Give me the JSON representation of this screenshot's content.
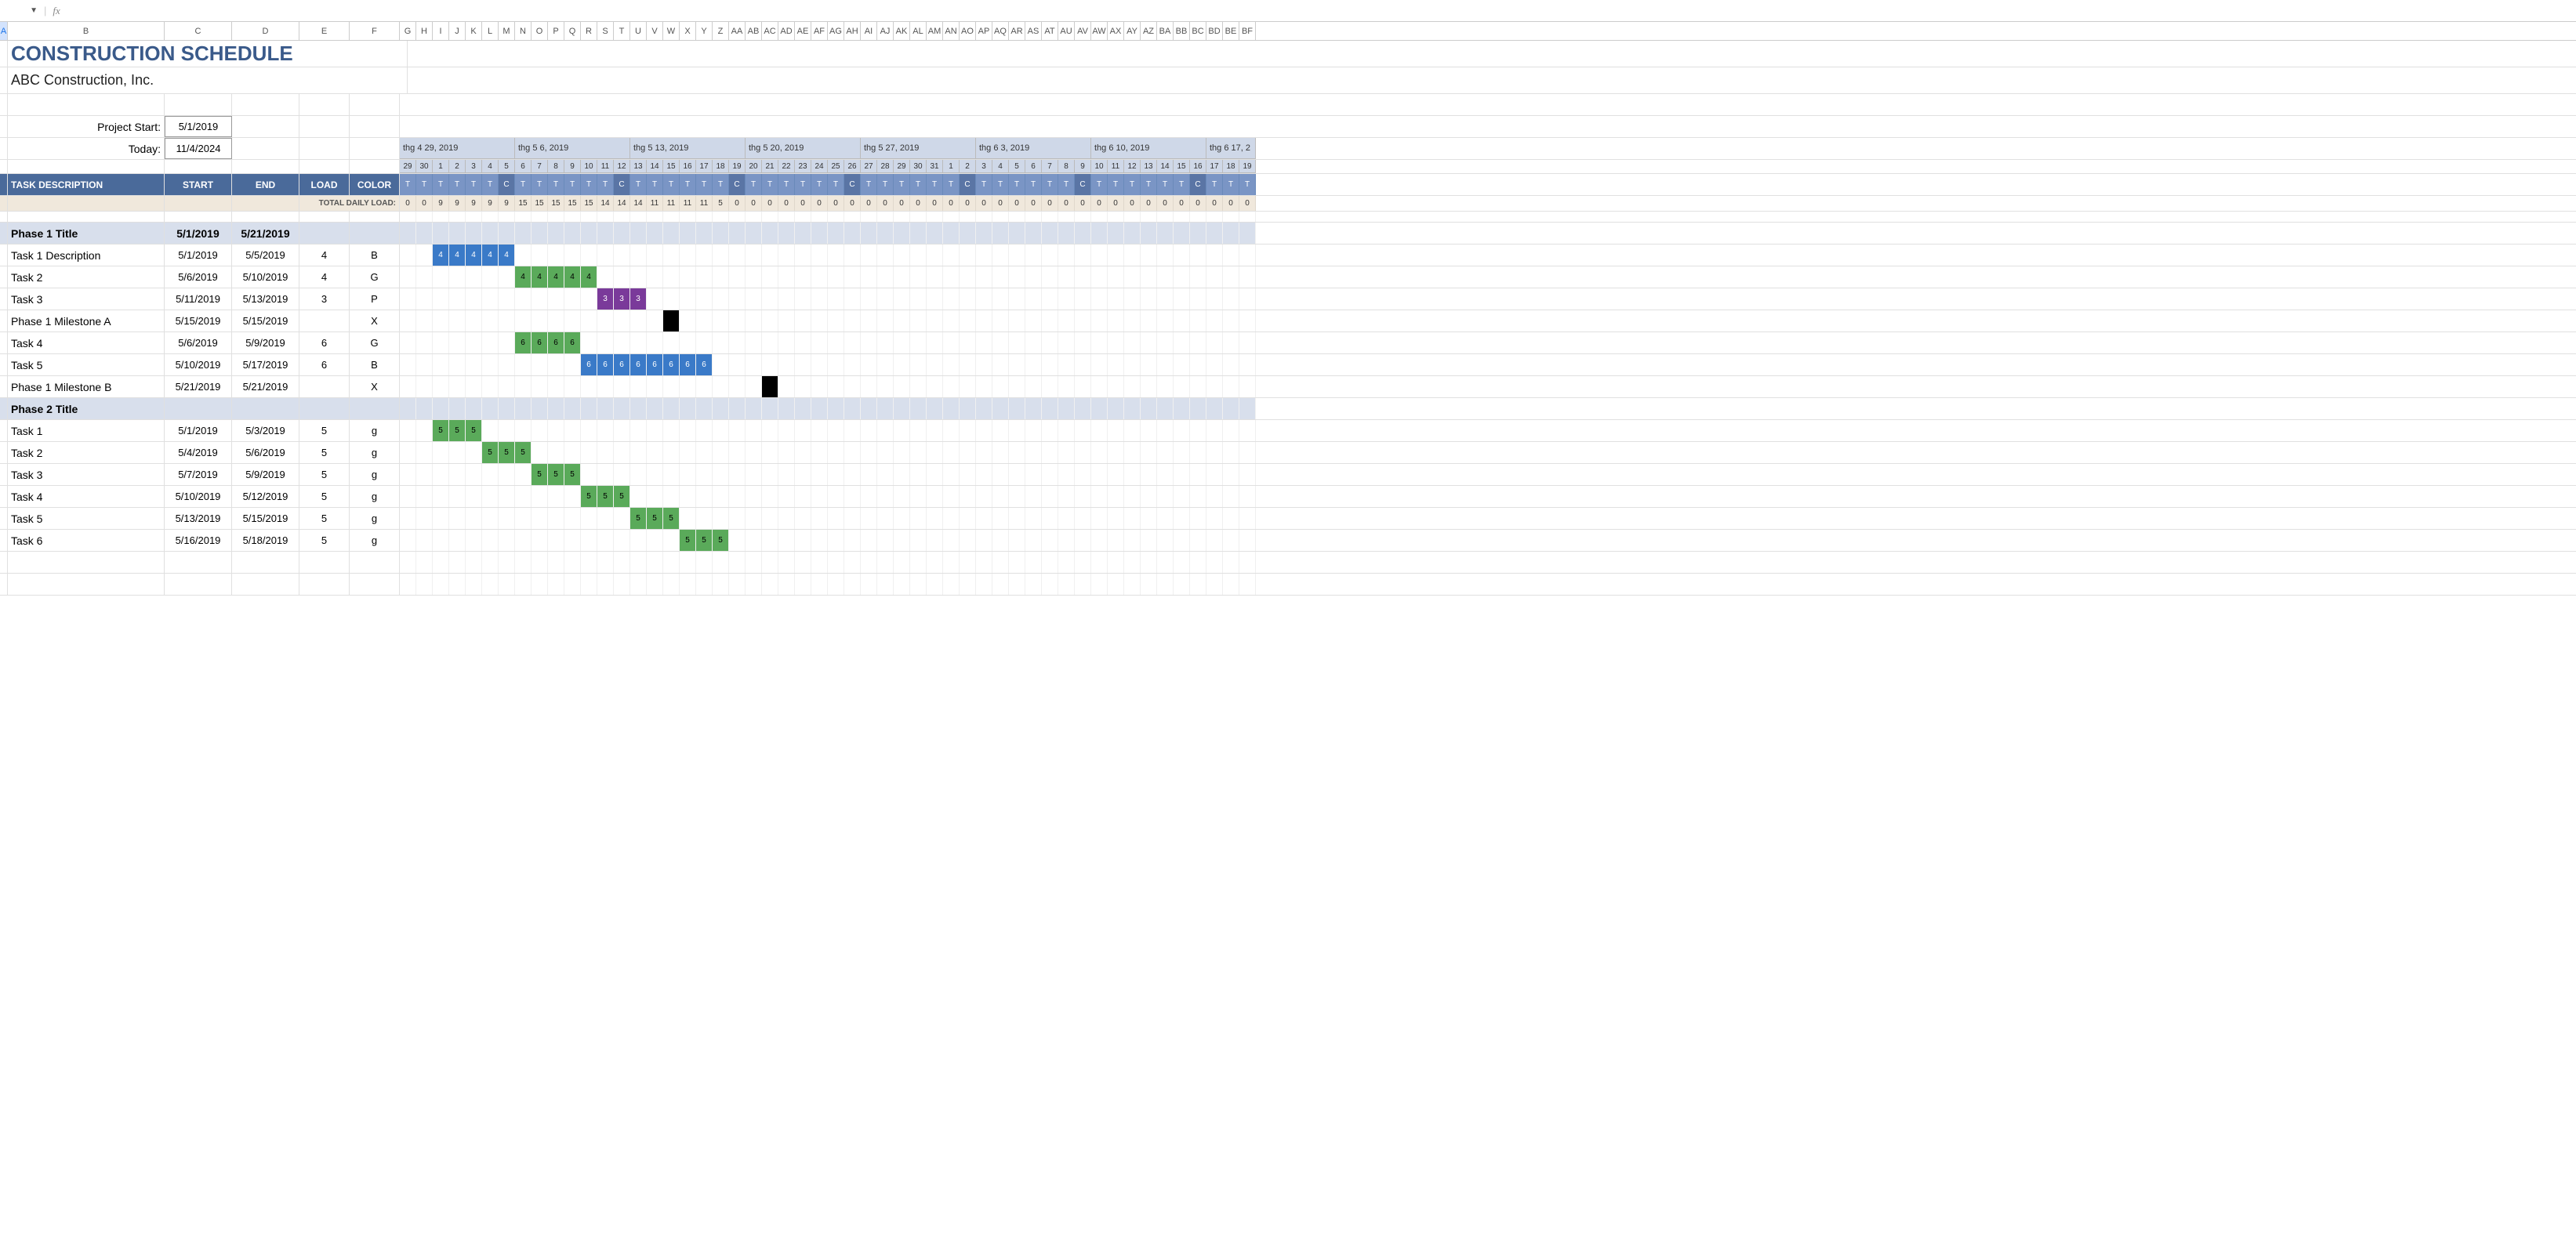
{
  "formula_bar": {
    "fx": "fx",
    "value": ""
  },
  "columns": [
    "A",
    "B",
    "C",
    "D",
    "E",
    "F",
    "G",
    "H",
    "I",
    "J",
    "K",
    "L",
    "M",
    "N",
    "O",
    "P",
    "Q",
    "R",
    "S",
    "T",
    "U",
    "V",
    "W",
    "X",
    "Y",
    "Z",
    "AA",
    "AB",
    "AC",
    "AD",
    "AE",
    "AF",
    "AG",
    "AH",
    "AI",
    "AJ",
    "AK",
    "AL",
    "AM",
    "AN",
    "AO",
    "AP",
    "AQ",
    "AR",
    "AS",
    "AT",
    "AU",
    "AV",
    "AW",
    "AX",
    "AY",
    "AZ",
    "BA",
    "BB",
    "BC",
    "BD",
    "BE",
    "BF"
  ],
  "title": "CONSTRUCTION SCHEDULE",
  "subtitle": "ABC Construction, Inc.",
  "project_start_label": "Project Start:",
  "project_start": "5/1/2019",
  "today_label": "Today:",
  "today": "11/4/2024",
  "weeks": [
    "thg 4 29, 2019",
    "thg 5 6, 2019",
    "thg 5 13, 2019",
    "thg 5 20, 2019",
    "thg 5 27, 2019",
    "thg 6 3, 2019",
    "thg 6 10, 2019",
    "thg 6 17, 2"
  ],
  "day_nums": [
    "29",
    "30",
    "1",
    "2",
    "3",
    "4",
    "5",
    "6",
    "7",
    "8",
    "9",
    "10",
    "11",
    "12",
    "13",
    "14",
    "15",
    "16",
    "17",
    "18",
    "19",
    "20",
    "21",
    "22",
    "23",
    "24",
    "25",
    "26",
    "27",
    "28",
    "29",
    "30",
    "31",
    "1",
    "2",
    "3",
    "4",
    "5",
    "6",
    "7",
    "8",
    "9",
    "10",
    "11",
    "12",
    "13",
    "14",
    "15",
    "16",
    "17",
    "18",
    "19"
  ],
  "headers": {
    "task": "TASK DESCRIPTION",
    "start": "START",
    "end": "END",
    "load": "LOAD",
    "color": "COLOR"
  },
  "day_types": [
    "T",
    "T",
    "T",
    "T",
    "T",
    "T",
    "C",
    "T",
    "T",
    "T",
    "T",
    "T",
    "T",
    "C",
    "T",
    "T",
    "T",
    "T",
    "T",
    "T",
    "C",
    "T",
    "T",
    "T",
    "T",
    "T",
    "T",
    "C",
    "T",
    "T",
    "T",
    "T",
    "T",
    "T",
    "C",
    "T",
    "T",
    "T",
    "T",
    "T",
    "T",
    "C",
    "T",
    "T",
    "T",
    "T",
    "T",
    "T",
    "C",
    "T",
    "T",
    "T"
  ],
  "total_load_label": "TOTAL DAILY LOAD:",
  "loads": [
    "0",
    "0",
    "9",
    "9",
    "9",
    "9",
    "9",
    "15",
    "15",
    "15",
    "15",
    "15",
    "14",
    "14",
    "14",
    "11",
    "11",
    "11",
    "11",
    "5",
    "0",
    "0",
    "0",
    "0",
    "0",
    "0",
    "0",
    "0",
    "0",
    "0",
    "0",
    "0",
    "0",
    "0",
    "0",
    "0",
    "0",
    "0",
    "0",
    "0",
    "0",
    "0",
    "0",
    "0",
    "0",
    "0",
    "0",
    "0",
    "0",
    "0",
    "0",
    "0"
  ],
  "rows": [
    {
      "type": "phase",
      "name": "Phase 1 Title",
      "start": "5/1/2019",
      "end": "5/21/2019",
      "bar": {
        "from": 2,
        "to": 22,
        "style": "gray",
        "vals": []
      }
    },
    {
      "type": "task",
      "name": "Task 1 Description",
      "start": "5/1/2019",
      "end": "5/5/2019",
      "load": "4",
      "color": "B",
      "bar": {
        "from": 2,
        "to": 6,
        "style": "blue",
        "vals": [
          "4",
          "4",
          "4",
          "4",
          "4"
        ]
      }
    },
    {
      "type": "task",
      "name": "Task 2",
      "start": "5/6/2019",
      "end": "5/10/2019",
      "load": "4",
      "color": "G",
      "bar": {
        "from": 7,
        "to": 11,
        "style": "green",
        "vals": [
          "4",
          "4",
          "4",
          "4",
          "4"
        ]
      }
    },
    {
      "type": "task",
      "name": "Task 3",
      "start": "5/11/2019",
      "end": "5/13/2019",
      "load": "3",
      "color": "P",
      "bar": {
        "from": 12,
        "to": 14,
        "style": "purple",
        "vals": [
          "3",
          "3",
          "3"
        ]
      }
    },
    {
      "type": "task",
      "name": "Phase 1 Milestone A",
      "start": "5/15/2019",
      "end": "5/15/2019",
      "load": "",
      "color": "X",
      "bar": {
        "from": 16,
        "to": 16,
        "style": "black",
        "vals": [
          ""
        ]
      }
    },
    {
      "type": "task",
      "name": "Task 4",
      "start": "5/6/2019",
      "end": "5/9/2019",
      "load": "6",
      "color": "G",
      "bar": {
        "from": 7,
        "to": 10,
        "style": "green",
        "vals": [
          "6",
          "6",
          "6",
          "6"
        ]
      }
    },
    {
      "type": "task",
      "name": "Task 5",
      "start": "5/10/2019",
      "end": "5/17/2019",
      "load": "6",
      "color": "B",
      "bar": {
        "from": 11,
        "to": 18,
        "style": "blue",
        "vals": [
          "6",
          "6",
          "6",
          "6",
          "6",
          "6",
          "6",
          "6"
        ]
      }
    },
    {
      "type": "task",
      "name": "Phase 1 Milestone B",
      "start": "5/21/2019",
      "end": "5/21/2019",
      "load": "",
      "color": "X",
      "bar": {
        "from": 22,
        "to": 22,
        "style": "black",
        "vals": [
          ""
        ]
      }
    },
    {
      "type": "phase",
      "name": "Phase 2 Title"
    },
    {
      "type": "task",
      "name": "Task 1",
      "start": "5/1/2019",
      "end": "5/3/2019",
      "load": "5",
      "color": "g",
      "bar": {
        "from": 2,
        "to": 4,
        "style": "green",
        "vals": [
          "5",
          "5",
          "5"
        ]
      }
    },
    {
      "type": "task",
      "name": "Task 2",
      "start": "5/4/2019",
      "end": "5/6/2019",
      "load": "5",
      "color": "g",
      "bar": {
        "from": 5,
        "to": 7,
        "style": "green",
        "vals": [
          "5",
          "5",
          "5"
        ]
      }
    },
    {
      "type": "task",
      "name": "Task 3",
      "start": "5/7/2019",
      "end": "5/9/2019",
      "load": "5",
      "color": "g",
      "bar": {
        "from": 8,
        "to": 10,
        "style": "green",
        "vals": [
          "5",
          "5",
          "5"
        ]
      }
    },
    {
      "type": "task",
      "name": "Task 4",
      "start": "5/10/2019",
      "end": "5/12/2019",
      "load": "5",
      "color": "g",
      "bar": {
        "from": 11,
        "to": 13,
        "style": "green",
        "vals": [
          "5",
          "5",
          "5"
        ]
      }
    },
    {
      "type": "task",
      "name": "Task 5",
      "start": "5/13/2019",
      "end": "5/15/2019",
      "load": "5",
      "color": "g",
      "bar": {
        "from": 14,
        "to": 16,
        "style": "green",
        "vals": [
          "5",
          "5",
          "5"
        ]
      }
    },
    {
      "type": "task",
      "name": "Task 6",
      "start": "5/16/2019",
      "end": "5/18/2019",
      "load": "5",
      "color": "g",
      "bar": {
        "from": 17,
        "to": 19,
        "style": "green",
        "vals": [
          "5",
          "5",
          "5"
        ]
      }
    }
  ]
}
